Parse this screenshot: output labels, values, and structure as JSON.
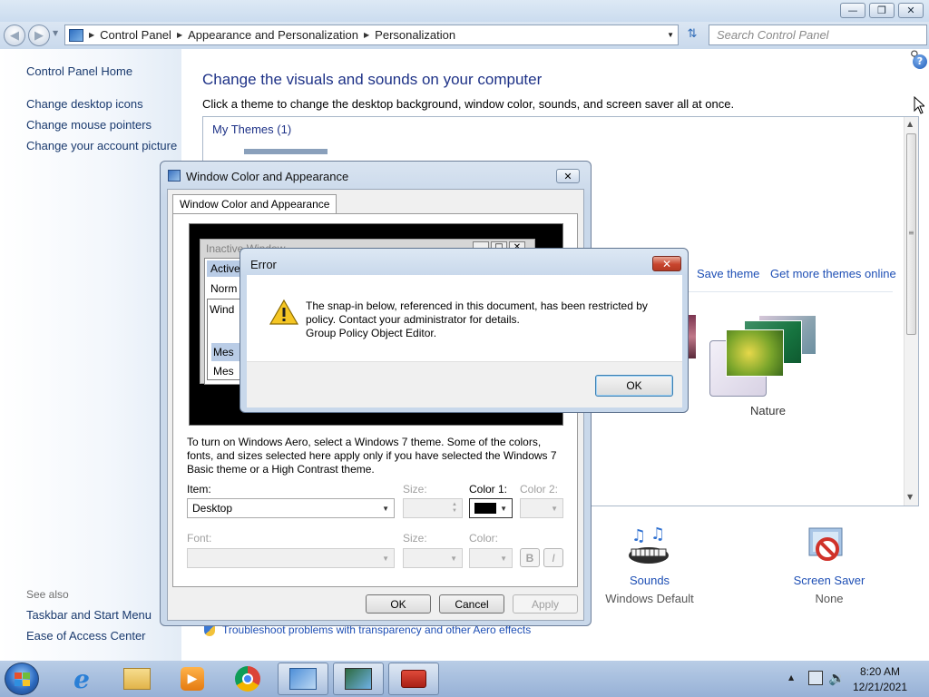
{
  "window": {
    "minimize_icon": "minimize-icon",
    "maximize_icon": "restore-icon",
    "close_icon": "close-icon"
  },
  "address_bar": {
    "breadcrumbs": [
      "Control Panel",
      "Appearance and Personalization",
      "Personalization"
    ],
    "search_placeholder": "Search Control Panel"
  },
  "sidebar": {
    "home": "Control Panel Home",
    "links": [
      "Change desktop icons",
      "Change mouse pointers",
      "Change your account picture"
    ],
    "see_also_heading": "See also",
    "see_also": [
      "Taskbar and Start Menu",
      "Ease of Access Center"
    ]
  },
  "main": {
    "title": "Change the visuals and sounds on your computer",
    "subtitle": "Click a theme to change the desktop background, window color, sounds, and screen saver all at once.",
    "my_themes": "My Themes (1)",
    "save_theme": "Save theme",
    "get_more": "Get more themes online",
    "theme_nature": "Nature",
    "sounds_label": "Sounds",
    "sounds_value": "Windows Default",
    "screensaver_label": "Screen Saver",
    "screensaver_value": "None",
    "troubleshoot": "Troubleshoot problems with transparency and other Aero effects"
  },
  "wc_dialog": {
    "title": "Window Color and Appearance",
    "tab": "Window Color and Appearance",
    "preview": {
      "inactive": "Inactive Window",
      "active": "Active",
      "normal": "Norm",
      "window_text": "Wind",
      "message1": "Mes",
      "message2": "Mes"
    },
    "description": "To turn on Windows Aero, select a Windows 7 theme.  Some of the colors, fonts, and sizes selected here apply only if you have selected the Windows 7 Basic theme or a High Contrast theme.",
    "item_label": "Item:",
    "item_value": "Desktop",
    "size_label": "Size:",
    "color1_label": "Color 1:",
    "color2_label": "Color 2:",
    "font_label": "Font:",
    "font_size_label": "Size:",
    "font_color_label": "Color:",
    "bold": "B",
    "italic": "I",
    "ok": "OK",
    "cancel": "Cancel",
    "apply": "Apply",
    "color1_value": "#000000"
  },
  "error_dialog": {
    "title": "Error",
    "line1": "The snap-in below, referenced in this document, has been restricted by",
    "line2": "policy. Contact your administrator for details.",
    "line3": "Group Policy Object Editor.",
    "ok": "OK",
    "icon": "warning-icon"
  },
  "taskbar": {
    "time": "8:20 AM",
    "date": "12/21/2021",
    "apps": [
      "internet-explorer-icon",
      "file-explorer-icon",
      "media-player-icon",
      "chrome-icon",
      "control-panel-icon",
      "display-icon",
      "toolbox-icon"
    ]
  },
  "colors": {
    "link": "#1e4fb5",
    "title": "#1e3287",
    "sidebar_link": "#1a3a6e"
  }
}
